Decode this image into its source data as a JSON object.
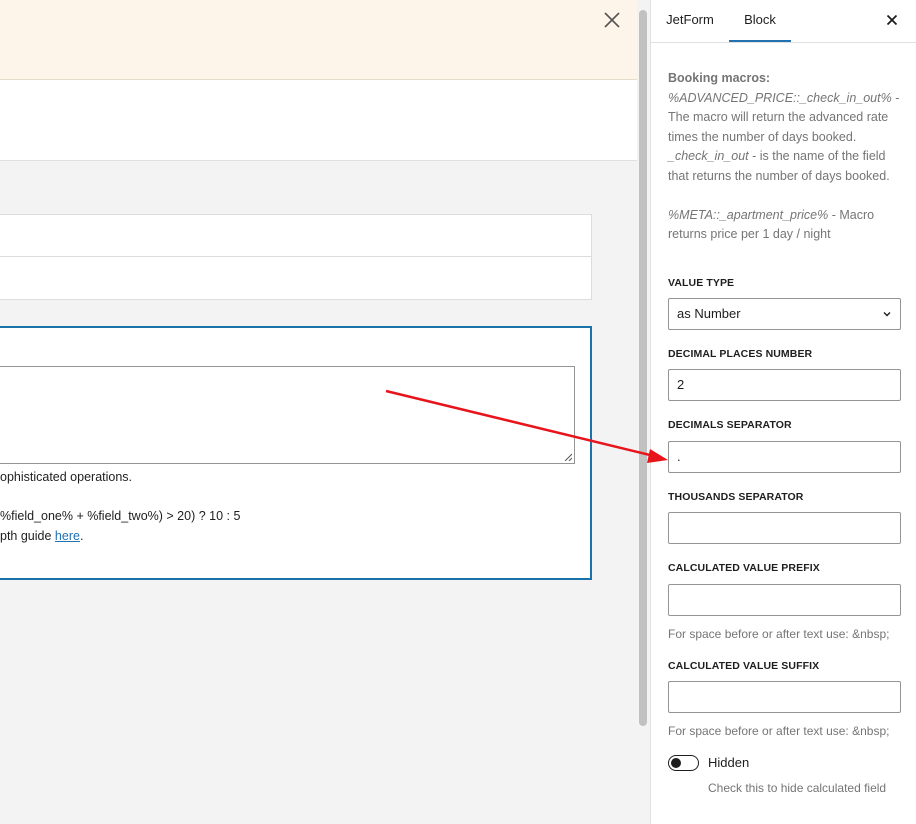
{
  "notice": {
    "close_icon": "close-icon"
  },
  "editor": {
    "help_line1": "ophisticated operations.",
    "help_line2": "%field_one% + %field_two%) > 20) ? 10 : 5",
    "help_line3_prefix": "pth guide ",
    "help_link": "here",
    "help_line3_suffix": "."
  },
  "sidebar": {
    "tabs": [
      {
        "label": "JetForm"
      },
      {
        "label": "Block"
      }
    ],
    "active_tab": "Block",
    "description": {
      "booking_title": "Booking macros:",
      "macro1": "%ADVANCED_PRICE::_check_in_out%",
      "macro1_text": " - The macro will return the advanced rate times the number of days booked.",
      "field_name": "_check_in_out",
      "field_text": " - is the name of the field that returns the number of days booked.",
      "macro2": "%META::_apartment_price%",
      "macro2_text": " - Macro returns price per 1 day / night"
    },
    "value_type": {
      "label": "VALUE TYPE",
      "value": "as Number"
    },
    "decimal_places": {
      "label": "DECIMAL PLACES NUMBER",
      "value": "2"
    },
    "decimals_separator": {
      "label": "DECIMALS SEPARATOR",
      "value": "."
    },
    "thousands_separator": {
      "label": "THOUSANDS SEPARATOR",
      "value": ""
    },
    "prefix": {
      "label": "CALCULATED VALUE PREFIX",
      "value": "",
      "hint": "For space before or after text use: &nbsp;"
    },
    "suffix": {
      "label": "CALCULATED VALUE SUFFIX",
      "value": "",
      "hint": "For space before or after text use: &nbsp;"
    },
    "hidden_toggle": {
      "label": "Hidden",
      "help": "Check this to hide calculated field",
      "checked": false
    }
  },
  "annotation": {
    "arrow_color": "#e8141b"
  }
}
